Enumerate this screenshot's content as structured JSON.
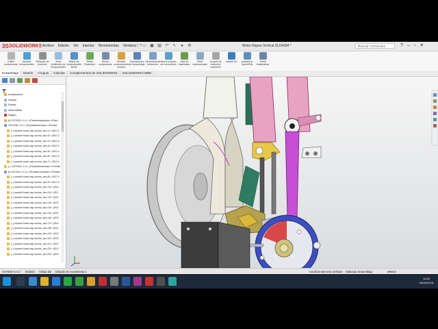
{
  "app": {
    "brand": "SOLIDWORKS",
    "brand_prefix": "3S",
    "menus": [
      "Archivo",
      "Edición",
      "Ver",
      "Insertar",
      "Herramientas",
      "Ventana",
      "?"
    ],
    "document_title": "Motor Napas Vertical.SLDASM *",
    "search_placeholder": "Buscar comandos"
  },
  "ribbon": [
    {
      "label": "Editar componente",
      "color": "#b3b3b3"
    },
    {
      "label": "Insertar componentes",
      "color": "#4f9fd6"
    },
    {
      "label": "Relación de posición",
      "color": "#8f8f8f"
    },
    {
      "label": "Vista preliminar de componentes",
      "color": "#9cbddb"
    },
    {
      "label": "Matriz de componentes lineal",
      "color": "#5b8fc7"
    },
    {
      "label": "Smart Fasteners",
      "color": "#6ea95c"
    },
    {
      "label": "Mover componente",
      "color": "#7a8fa6"
    },
    {
      "label": "Mostrar componentes ocultos",
      "color": "#d8a044"
    },
    {
      "label": "Operaciones de ensamblaje",
      "color": "#5c82b8"
    },
    {
      "label": "Geometría de referencia",
      "color": "#7c9ec7"
    },
    {
      "label": "Nuevo estudio de movimiento",
      "color": "#5aa1c8"
    },
    {
      "label": "Lista de materiales",
      "color": "#6f9a4c"
    },
    {
      "label": "Vista explosionada",
      "color": "#8fa8c0"
    },
    {
      "label": "Croquis de líneas de explosión",
      "color": "#a5a5a5"
    },
    {
      "label": "Instant 3D",
      "color": "#3c7fc0"
    },
    {
      "label": "Actualizar SpeedPak",
      "color": "#5e8ebd"
    },
    {
      "label": "Tomar instantánea",
      "color": "#6b86a8"
    }
  ],
  "command_tabs": [
    "Ensamblaje",
    "Diseño",
    "Croquis",
    "Calcular",
    "Complementos de SOLIDWORKS",
    "SOLIDWORKS MBD"
  ],
  "active_command_tab": "Ensamblaje",
  "feature_tree": [
    {
      "label": "Anotaciones",
      "icon": "annotations-icon",
      "color": "#d9b343",
      "indent": 0
    },
    {
      "label": "Alzado",
      "icon": "plane-icon",
      "color": "#9fb7cf",
      "indent": 0
    },
    {
      "label": "Planta",
      "icon": "plane-icon",
      "color": "#9fb7cf",
      "indent": 0
    },
    {
      "label": "Vista lateral",
      "icon": "plane-icon",
      "color": "#9fb7cf",
      "indent": 0
    },
    {
      "label": "Origen",
      "icon": "origin-icon",
      "color": "#c0392b",
      "indent": 0
    },
    {
      "label": "(f) VS7003~1<1> (Predeterminado<<Pred",
      "icon": "part-icon",
      "color": "#e8b94a",
      "indent": 0
    },
    {
      "label": "VS7006~1<1> (Predeterminado<<Predet",
      "icon": "assembly-icon",
      "color": "#7aa0c8",
      "indent": 0
    },
    {
      "label": "(-) socket head cap screw_iso<1> (ISO 4",
      "icon": "part-icon",
      "color": "#e8b94a",
      "indent": 1
    },
    {
      "label": "(-) socket head cap screw_iso<2> (ISO 4",
      "icon": "part-icon",
      "color": "#e8b94a",
      "indent": 1
    },
    {
      "label": "(-) socket head cap screw_iso<3> (ISO 4",
      "icon": "part-icon",
      "color": "#e8b94a",
      "indent": 1
    },
    {
      "label": "(-) socket head cap screw_iso<4> (ISO 4",
      "icon": "part-icon",
      "color": "#e8b94a",
      "indent": 1
    },
    {
      "label": "(-) socket head cap screw_iso<5> (ISO 4",
      "icon": "part-icon",
      "color": "#e8b94a",
      "indent": 1
    },
    {
      "label": "(-) socket head cap screw_iso<6> (ISO 4",
      "icon": "part-icon",
      "color": "#e8b94a",
      "indent": 1
    },
    {
      "label": "(-) socket head cap screw_iso<7> (ISO 4",
      "icon": "part-icon",
      "color": "#e8b94a",
      "indent": 1
    },
    {
      "label": "(-) VS7016~1<1> (Predeterminado<<Predet",
      "icon": "part-icon",
      "color": "#e8b94a",
      "indent": 0
    },
    {
      "label": "(f) VS7011~1<1> (Predeterminado<<Predet",
      "icon": "assembly-icon",
      "color": "#7aa0c8",
      "indent": 0
    },
    {
      "label": "(-) socket head cap screw_iso<8> (ISO 4",
      "icon": "part-icon",
      "color": "#e8b94a",
      "indent": 1
    },
    {
      "label": "(-) socket head cap screw_iso<9> (ISO 4",
      "icon": "part-icon",
      "color": "#e8b94a",
      "indent": 1
    },
    {
      "label": "(-) socket head cap screw_iso<10> (ISO",
      "icon": "part-icon",
      "color": "#e8b94a",
      "indent": 1
    },
    {
      "label": "(-) socket head cap screw_iso<11> (ISO",
      "icon": "part-icon",
      "color": "#e8b94a",
      "indent": 1
    },
    {
      "label": "(-) socket head cap screw_iso<12> (ISO",
      "icon": "part-icon",
      "color": "#e8b94a",
      "indent": 1
    },
    {
      "label": "(-) socket head cap screw_iso<13> (ISO",
      "icon": "part-icon",
      "color": "#e8b94a",
      "indent": 1
    },
    {
      "label": "(-) socket head cap screw_iso<14> (ISO",
      "icon": "part-icon",
      "color": "#e8b94a",
      "indent": 1
    },
    {
      "label": "(-) socket head cap screw_iso<15> (ISO",
      "icon": "part-icon",
      "color": "#e8b94a",
      "indent": 1
    },
    {
      "label": "(-) socket head cap screw_iso<16> (ISO",
      "icon": "part-icon",
      "color": "#e8b94a",
      "indent": 1
    },
    {
      "label": "(-) socket head cap screw_iso<17> (ISO",
      "icon": "part-icon",
      "color": "#e8b94a",
      "indent": 1
    },
    {
      "label": "(-) socket head cap screw_iso<18> (ISO",
      "icon": "part-icon",
      "color": "#e8b94a",
      "indent": 1
    },
    {
      "label": "(-) socket head cap screw_iso<19> (ISO",
      "icon": "part-icon",
      "color": "#e8b94a",
      "indent": 1
    },
    {
      "label": "(-) socket head cap screw_iso<20> (ISO",
      "icon": "part-icon",
      "color": "#e8b94a",
      "indent": 1
    },
    {
      "label": "(-) socket head cap screw_iso<21> (ISO",
      "icon": "part-icon",
      "color": "#e8b94a",
      "indent": 1
    },
    {
      "label": "(-) socket head cap screw_iso<22> (ISO",
      "icon": "part-icon",
      "color": "#e8b94a",
      "indent": 1
    },
    {
      "label": "(-) socket head cap screw_iso<23> (ISO",
      "icon": "part-icon",
      "color": "#e8b94a",
      "indent": 1
    }
  ],
  "bottom_tabs": [
    "VS7006~1<1>",
    "Modelo",
    "Vistas 3D",
    "Estudio de movimiento 1"
  ],
  "status": {
    "state": "Insuficientemente definido",
    "mode": "Editando Ensamblaje",
    "units": "MMGS"
  },
  "taskbar": {
    "time": "12:00",
    "date": "04/02/2016"
  }
}
